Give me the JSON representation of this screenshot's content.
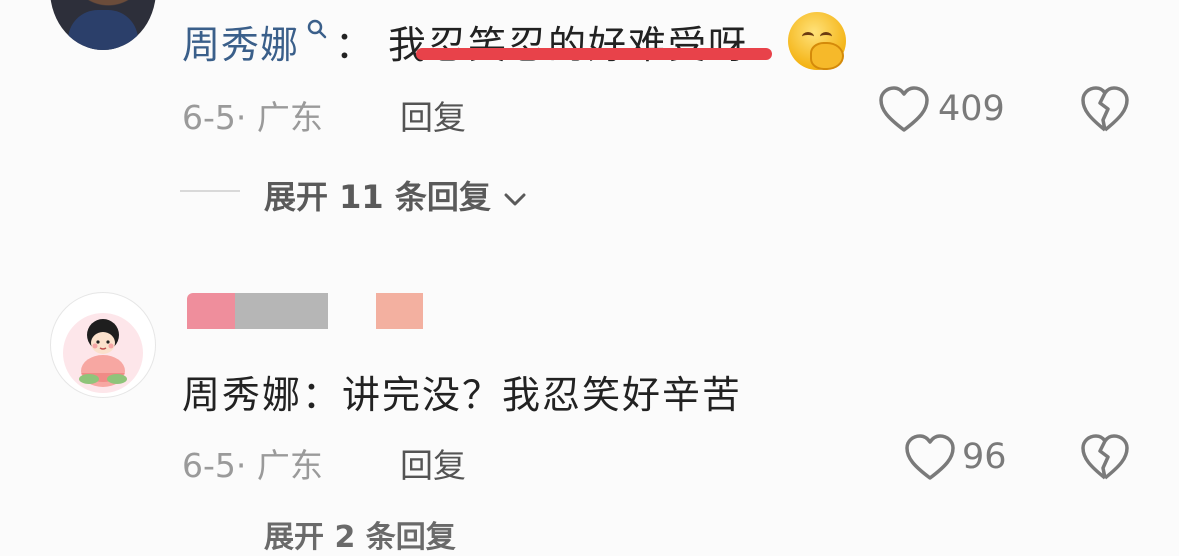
{
  "comment1": {
    "username": "周秀娜",
    "colon": "：",
    "text": "我忍笑忍的好难受呀",
    "date_location": "6-5· 广东",
    "reply_label": "回复",
    "like_count": "409",
    "expand_label": "展开 11 条回复"
  },
  "comment2": {
    "text": "周秀娜：讲完没？我忍笑好辛苦",
    "date_location": "6-5· 广东",
    "reply_label": "回复",
    "like_count": "96",
    "expand_label_partial": "展开 2 条回复"
  },
  "colors": {
    "username_blue": "#3a5f8a",
    "highlight_red": "#e8424a",
    "meta_gray": "#9a9a9a"
  },
  "icons": [
    "search-icon",
    "grin-emoji-icon",
    "heart-icon",
    "broken-heart-icon",
    "chevron-down-icon"
  ]
}
